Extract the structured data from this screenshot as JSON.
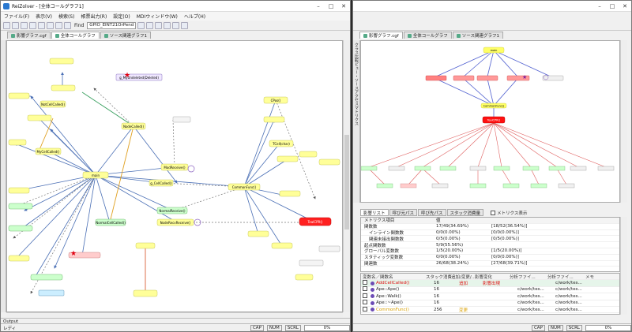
{
  "win1": {
    "title": "ReiZolver - [全体コールグラフ1]",
    "menu": [
      "ファイル(F)",
      "表示(V)",
      "検索(S)",
      "帳票出力(R)",
      "設定(O)",
      "MDIウィンドウ(W)",
      "ヘルプ(H)"
    ],
    "toolbar": {
      "find_label": "Find",
      "find_value": "GPIO_EINT21OrPend"
    },
    "tabs": [
      "影響グラフ.cgf",
      "全体コールグラフ",
      "ソース関連グラフ1"
    ],
    "output_label": "Output",
    "status": {
      "left": "レディ",
      "cap": "CAP",
      "num": "NUM",
      "scrl": "SCRL",
      "pct": "0%"
    }
  },
  "win2": {
    "tabs": [
      "影響グラフ.cgf",
      "全体コールグラフ",
      "ソース関連グラフ1"
    ],
    "side_label": "クラス比較ビュー・ソースアクセスマトリクス",
    "bottom_tabs": [
      "影響リスト",
      "呼び元パス",
      "呼び先パス",
      "スタック消費量"
    ],
    "metrics_checkbox": "メトリクス表示",
    "metrics_header": {
      "k": "メトリクス項目",
      "v": "値"
    },
    "metrics": [
      {
        "k": "関数数",
        "v": "17/49(34.69%)",
        "v2": "[18/52(36.54%)]"
      },
      {
        "k": "インライン関数数",
        "v": "0/0(0.00%)",
        "v2": "[0/0(0.00%)]"
      },
      {
        "k": "関連未接出関数数",
        "v": "0/5(0.00%)",
        "v2": "[0/5(0.00%)]"
      },
      {
        "k": "起点関数数",
        "v": "5/9(55.56%)",
        "v2": ""
      },
      {
        "k": "グローバル変数数",
        "v": "1/5(20.00%)",
        "v2": "[1/5(20.00%)]"
      },
      {
        "k": "スタティック変数数",
        "v": "0/0(0.00%)",
        "v2": "[0/0(0.00%)]"
      },
      {
        "k": "関連数",
        "v": "26/68(38.24%)",
        "v2": "[27/68(39.71%)]"
      }
    ],
    "var_header": [
      "変数名／関数名",
      "スタック消費量",
      "追加/変更/...",
      "影響変化",
      "分析ファイ...",
      "分析ファイ...",
      "メモ"
    ],
    "var_rows": [
      {
        "name": "AddCellCalled()",
        "stack": "16",
        "change": "追加",
        "effect": "影響出現",
        "f1": "",
        "f2": "c/work/tes...",
        "memo": "",
        "hl": true
      },
      {
        "name": "Ape::Ape()",
        "stack": "16",
        "change": "",
        "effect": "",
        "f1": "c/work/tes...",
        "f2": "c/work/tes...",
        "memo": "",
        "hl": false
      },
      {
        "name": "Ape::Walk()",
        "stack": "16",
        "change": "",
        "effect": "",
        "f1": "c/work/tes...",
        "f2": "c/work/tes...",
        "memo": "",
        "hl": false
      },
      {
        "name": "Ape::~Ape()",
        "stack": "16",
        "change": "",
        "effect": "",
        "f1": "c/work/tes...",
        "f2": "c/work/tes...",
        "memo": "",
        "hl": false
      },
      {
        "name": "CommonFunc()",
        "stack": "256",
        "change": "変更",
        "effect": "",
        "f1": "c/work/tes...",
        "f2": "c/work/tes...",
        "memo": "",
        "hl": false
      }
    ],
    "status": {
      "cap": "CAP",
      "num": "NUM",
      "scrl": "SCRL",
      "pct": "0%"
    }
  },
  "graph1": {
    "nodes": {
      "main": "main",
      "common": "CommonFunc()",
      "teal": "TealCPR()",
      "nodecalled": "NodeCalled()",
      "gcalled": "g_CellCalled()",
      "nremove": "NodeRemove()",
      "mover": "ModReceive()",
      "normalrecv": "NormalReceive()",
      "nrecvmod": "NodeRecvReceive()",
      "notcalled": "NotCellCalled()",
      "normalcalled": "NormalCellCalled()",
      "mycalled": "MyCellCalled()",
      "undeleted": "g_MyUndeleted(Deleted)",
      "cpos": "CPos()",
      "tcell": "TCell(char)"
    }
  },
  "graph2": {
    "main": "main",
    "common": "CommonFunc()",
    "teal": "TealCPR()"
  }
}
